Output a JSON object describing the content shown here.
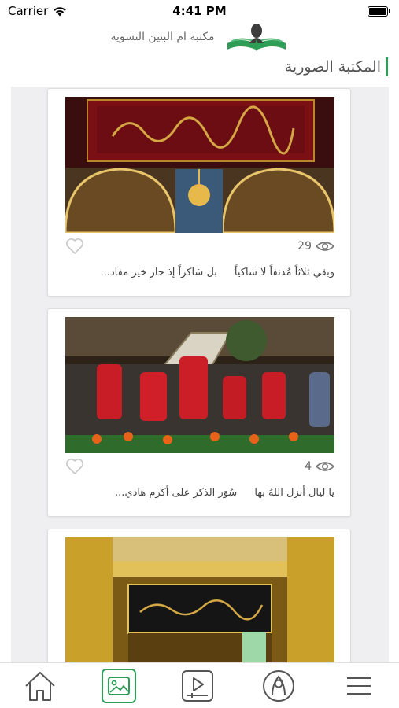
{
  "status_bar": {
    "carrier": "Carrier",
    "time": "4:41 PM"
  },
  "header": {
    "library_name": "مكتبة ام البنين النسوية"
  },
  "section": {
    "title": "المكتبة الصورية"
  },
  "posts": [
    {
      "views": "29",
      "caption_part1": "وبقي ثلاثاً مُدنفاً لا شاكياً",
      "caption_part2": "بل شاكراً إذ حاز خير مفاد..."
    },
    {
      "views": "4",
      "caption_part1": "يا ليال أنزل اللهُ بها",
      "caption_part2": "سُوَر الذكر على أكرم هادي..."
    },
    {
      "views": "",
      "caption_part1": "",
      "caption_part2": ""
    }
  ],
  "tabs": [
    {
      "icon": "home-icon"
    },
    {
      "icon": "gallery-icon",
      "active": true
    },
    {
      "icon": "video-icon"
    },
    {
      "icon": "profile-icon"
    },
    {
      "icon": "menu-icon"
    }
  ],
  "colors": {
    "accent": "#2e9e57",
    "feed_background": "#efeff1"
  }
}
